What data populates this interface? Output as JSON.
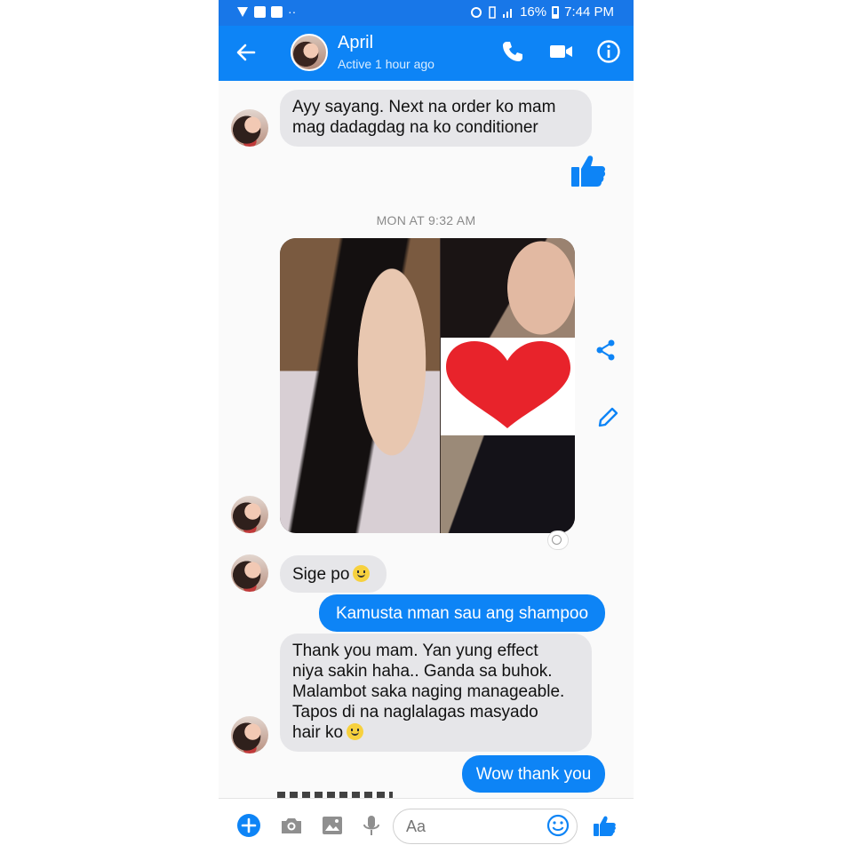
{
  "status_bar": {
    "battery": "16%",
    "time": "7:44 PM",
    "left_icons": [
      "shield-icon",
      "facebook-icon",
      "image-icon",
      "dots-icon"
    ],
    "right_icons": [
      "alarm-icon",
      "vibrate-icon",
      "signal-icon",
      "battery-icon"
    ]
  },
  "header": {
    "contact_name": "April",
    "status": "Active 1 hour ago",
    "icons": [
      "back-arrow-icon",
      "phone-icon",
      "video-icon",
      "info-icon"
    ],
    "accent_color": "#0d84f6"
  },
  "messages": {
    "m1": "Ayy sayang. Next na order ko mam\nmag dadagdag na ko conditioner",
    "timestamp": "MON AT 9:32 AM",
    "m2": "Sige po",
    "m3": "Kamusta nman sau ang shampoo",
    "m4": "Thank you mam. Yan yung effect\nniya sakin haha.. Ganda sa buhok.\nMalambot saka naging manageable.\nTapos di na naglalagas masyado\nhair ko",
    "m5": "Wow thank you"
  },
  "composer": {
    "placeholder": "Aa",
    "icons": [
      "plus-icon",
      "camera-icon",
      "gallery-icon",
      "microphone-icon",
      "emoji-icon",
      "like-icon"
    ]
  },
  "colors": {
    "outgoing_bubble": "#0d84f6",
    "incoming_bubble": "#e6e6e9",
    "heart": "#e8232b"
  }
}
